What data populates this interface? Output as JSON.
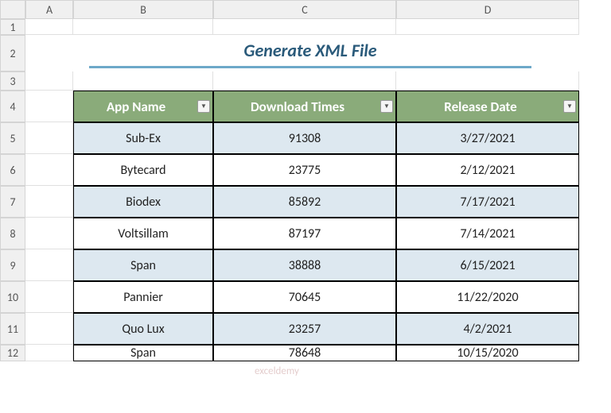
{
  "columns": [
    "A",
    "B",
    "C",
    "D"
  ],
  "rows": [
    "1",
    "2",
    "3",
    "4",
    "5",
    "6",
    "7",
    "8",
    "9",
    "10",
    "11",
    "12"
  ],
  "title": "Generate XML File",
  "headers": [
    "App Name",
    "Download Times",
    "Release Date"
  ],
  "data": [
    {
      "app": "Sub-Ex",
      "dl": "91308",
      "date": "3/27/2021"
    },
    {
      "app": "Bytecard",
      "dl": "23775",
      "date": "2/12/2021"
    },
    {
      "app": "Biodex",
      "dl": "85892",
      "date": "7/17/2021"
    },
    {
      "app": "Voltsillam",
      "dl": "87197",
      "date": "7/14/2021"
    },
    {
      "app": "Span",
      "dl": "38888",
      "date": "6/15/2021"
    },
    {
      "app": "Pannier",
      "dl": "70645",
      "date": "11/22/2020"
    },
    {
      "app": "Quo Lux",
      "dl": "23257",
      "date": "4/2/2021"
    },
    {
      "app": "Span",
      "dl": "78648",
      "date": "10/15/2020"
    }
  ],
  "watermark": "exceldemy"
}
